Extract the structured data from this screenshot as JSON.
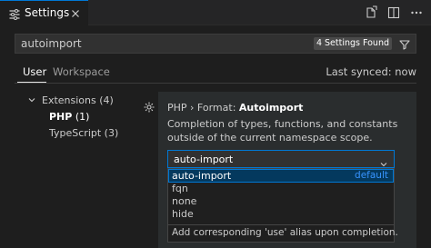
{
  "tab": {
    "label": "Settings"
  },
  "search": {
    "value": "autoimport",
    "results_badge": "4 Settings Found"
  },
  "scope_tabs": [
    {
      "label": "User"
    },
    {
      "label": "Workspace"
    }
  ],
  "sync_status": "Last synced: now",
  "tree": {
    "extensions": "Extensions (4)",
    "php_name": "PHP",
    "php_count": "(1)",
    "typescript": "TypeScript (3)"
  },
  "setting": {
    "category": "PHP › Format: ",
    "name": "Autoimport",
    "description": "Completion of types, functions, and constants outside of the current namespace scope.",
    "selected_value": "auto-import",
    "options": [
      {
        "label": "auto-import",
        "badge": "default"
      },
      {
        "label": "fqn"
      },
      {
        "label": "none"
      },
      {
        "label": "hide"
      }
    ],
    "option_description": "Add corresponding 'use' alias upon completion."
  },
  "colors": {
    "accent": "#0078d4",
    "link": "#3794ff",
    "background": "#1e1e1e"
  }
}
